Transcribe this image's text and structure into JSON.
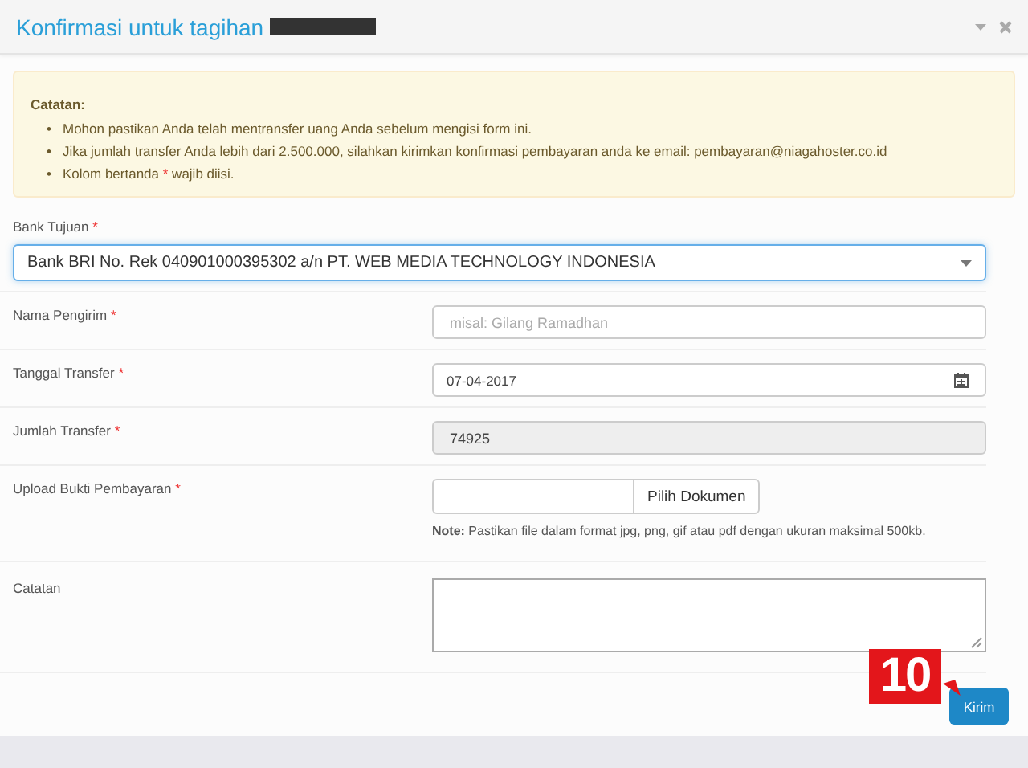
{
  "window": {
    "title": "Konfirmasi untuk tagihan",
    "title_redacted": true
  },
  "notice": {
    "heading": "Catatan:",
    "bullet": "•",
    "items": [
      {
        "text": "Mohon pastikan Anda telah mentransfer uang Anda sebelum mengisi form ini."
      },
      {
        "text": "Jika jumlah transfer Anda lebih dari 2.500.000, silahkan kirimkan konfirmasi pembayaran anda ke email: pembayaran@niagahoster.co.id"
      },
      {
        "text": "Kolom bertanda",
        "mark": "*",
        "text_after": "wajib diisi."
      }
    ]
  },
  "fields": [
    {
      "kind": "select",
      "label": "Bank Tujuan",
      "mark": "*",
      "value": "Bank BRI No. Rek 040901000395302 a/n PT. WEB MEDIA TECHNOLOGY INDONESIA",
      "focused": true
    },
    {
      "kind": "text",
      "label": "Nama Pengirim",
      "mark": "*",
      "placeholder": "misal: Gilang Ramadhan",
      "disabled": false
    },
    {
      "kind": "date",
      "label": "Tanggal Transfer",
      "mark": "*",
      "value": "07-04-2017"
    },
    {
      "kind": "text",
      "label": "Jumlah Transfer",
      "mark": "*",
      "value": "74925",
      "disabled": true
    },
    {
      "kind": "file",
      "label": "Upload Bukti Pembayaran",
      "mark": "*",
      "button": "Pilih Dokumen",
      "note": "**Note:** Pastikan file dalam format jpg, png, gif atau pdf dengan ukuran maksimal 500kb."
    },
    {
      "kind": "textarea",
      "label": "Catatan"
    }
  ],
  "submit": {
    "label": "Kirim"
  },
  "step_badge": {
    "label": "10"
  }
}
